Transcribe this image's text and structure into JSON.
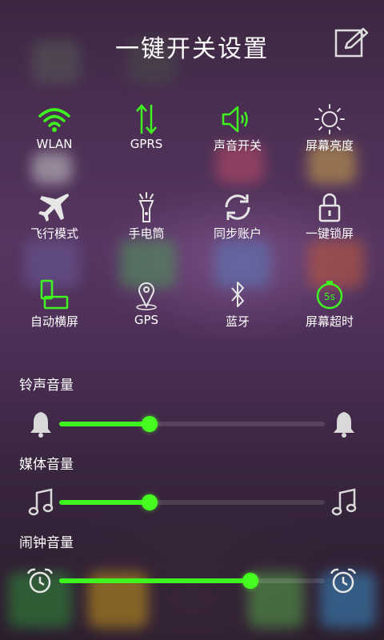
{
  "title": "一键开关设置",
  "edit_icon": "edit-icon",
  "colors": {
    "accent": "#3ff51f",
    "inactive_icon": "#e6e6e6"
  },
  "toggles": [
    {
      "label": "WLAN",
      "icon": "wifi-icon",
      "active": true
    },
    {
      "label": "GPRS",
      "icon": "data-arrows-icon",
      "active": true
    },
    {
      "label": "声音开关",
      "icon": "speaker-icon",
      "active": true
    },
    {
      "label": "屏幕亮度",
      "icon": "brightness-icon",
      "active": false
    },
    {
      "label": "飞行模式",
      "icon": "airplane-icon",
      "active": false
    },
    {
      "label": "手电筒",
      "icon": "flashlight-icon",
      "active": false
    },
    {
      "label": "同步账户",
      "icon": "sync-icon",
      "active": false
    },
    {
      "label": "一键锁屏",
      "icon": "lock-icon",
      "active": false
    },
    {
      "label": "自动横屏",
      "icon": "rotate-icon",
      "active": true
    },
    {
      "label": "GPS",
      "icon": "gps-icon",
      "active": false
    },
    {
      "label": "蓝牙",
      "icon": "bluetooth-icon",
      "active": false
    },
    {
      "label": "屏幕超时",
      "icon": "timeout-icon",
      "active": true,
      "badge": "5s"
    }
  ],
  "volumes": [
    {
      "label": "铃声音量",
      "icon": "bell-icon",
      "level": 0.34
    },
    {
      "label": "媒体音量",
      "icon": "music-note-icon",
      "level": 0.34
    },
    {
      "label": "闹钟音量",
      "icon": "alarm-clock-icon",
      "level": 0.72
    }
  ]
}
